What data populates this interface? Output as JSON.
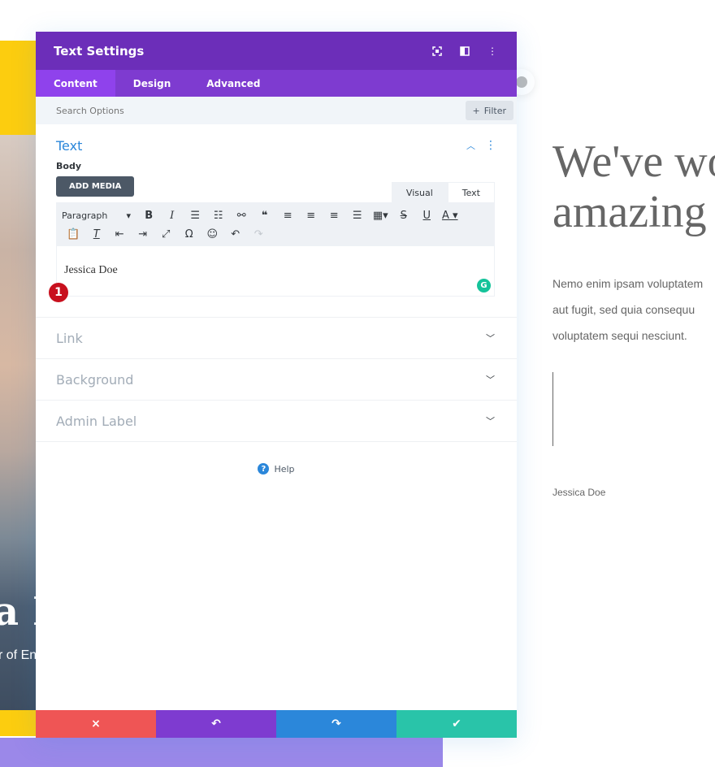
{
  "modal": {
    "title": "Text Settings",
    "header_icons": [
      "focus-mode-icon",
      "split-view-icon",
      "more-options-icon"
    ],
    "tabs": [
      {
        "label": "Content",
        "active": true
      },
      {
        "label": "Design",
        "active": false
      },
      {
        "label": "Advanced",
        "active": false
      }
    ],
    "search": {
      "placeholder": "Search Options",
      "value": ""
    },
    "filter_label": "Filter",
    "sections": {
      "text": {
        "title": "Text",
        "body_label": "Body",
        "add_media_label": "ADD MEDIA",
        "mode_tabs": [
          {
            "label": "Visual",
            "active": true
          },
          {
            "label": "Text",
            "active": false
          }
        ],
        "format_select": "Paragraph",
        "editor_content": "Jessica Doe",
        "step_badge": "1"
      },
      "collapsed": [
        {
          "title": "Link"
        },
        {
          "title": "Background"
        },
        {
          "title": "Admin Label"
        }
      ]
    },
    "help_label": "Help",
    "footer": {
      "cancel_icon": "×",
      "undo_icon": "↶",
      "redo_icon": "↷",
      "save_icon": "✔"
    }
  },
  "page": {
    "heading_line1": "We've wo",
    "heading_line2": "amazing",
    "body_lines": [
      "Nemo enim ipsam voluptatem",
      "aut fugit, sed quia consequu",
      "voluptatem sequi nesciunt."
    ],
    "author": "Jessica Doe",
    "photo_title_fragment": "a D",
    "photo_subtitle_fragment": "r of En"
  },
  "colors": {
    "header_purple": "#6c2eb9",
    "tab_purple": "#7e3bd0",
    "active_tab": "#8f42ec",
    "accent_blue": "#2b87da",
    "cancel_red": "#ef5555",
    "save_green": "#29c4a9",
    "badge_red": "#c8101e"
  }
}
